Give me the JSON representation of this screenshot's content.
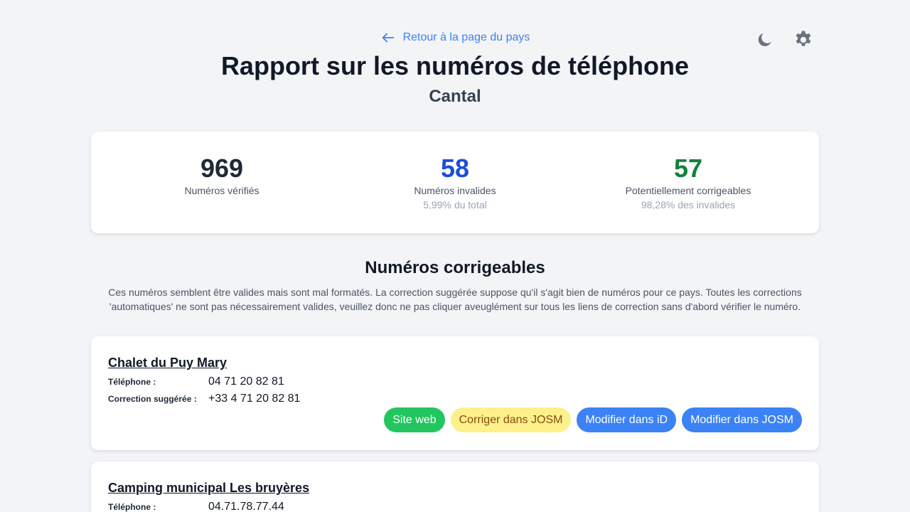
{
  "header": {
    "back_label": "Retour à la page du pays",
    "title": "Rapport sur les numéros de téléphone",
    "subtitle": "Cantal",
    "icons": [
      "moon-icon",
      "gear-icon"
    ]
  },
  "stats": [
    {
      "value": "969",
      "label": "Numéros vérifiés",
      "sub": "",
      "color": "#1f2937"
    },
    {
      "value": "58",
      "label": "Numéros invalides",
      "sub": "5,99% du total",
      "color": "#1d4ed8"
    },
    {
      "value": "57",
      "label": "Potentiellement corrigeables",
      "sub": "98,28% des invalides",
      "color": "#15803d"
    }
  ],
  "section": {
    "title": "Numéros corrigeables",
    "description": "Ces numéros semblent être valides mais sont mal formatés. La correction suggérée suppose qu'il s'agit bien de numéros pour ce pays. Toutes les corrections 'automatiques' ne sont pas nécessairement valides, veuillez donc ne pas cliquer aveuglément sur tous les liens de correction sans d'abord vérifier le numéro."
  },
  "labels": {
    "phone": "Téléphone :",
    "suggested": "Correction suggérée :"
  },
  "entries": [
    {
      "name": "Chalet du Puy Mary",
      "phone": "04 71 20 82 81",
      "suggested": "+33 4 71 20 82 81",
      "buttons": {
        "website": "Site web",
        "fix_josm": "Corriger dans JOSM",
        "edit_id": "Modifier dans iD",
        "edit_josm": "Modifier dans JOSM"
      }
    },
    {
      "name": "Camping municipal Les bruyères",
      "phone": "04.71.78.77.44"
    }
  ],
  "colors": {
    "background": "#f3f4f6",
    "link": "#3b82f6",
    "green_button": "#22c55e",
    "yellow_button": "#fef08a",
    "blue_button": "#3b82f6"
  }
}
